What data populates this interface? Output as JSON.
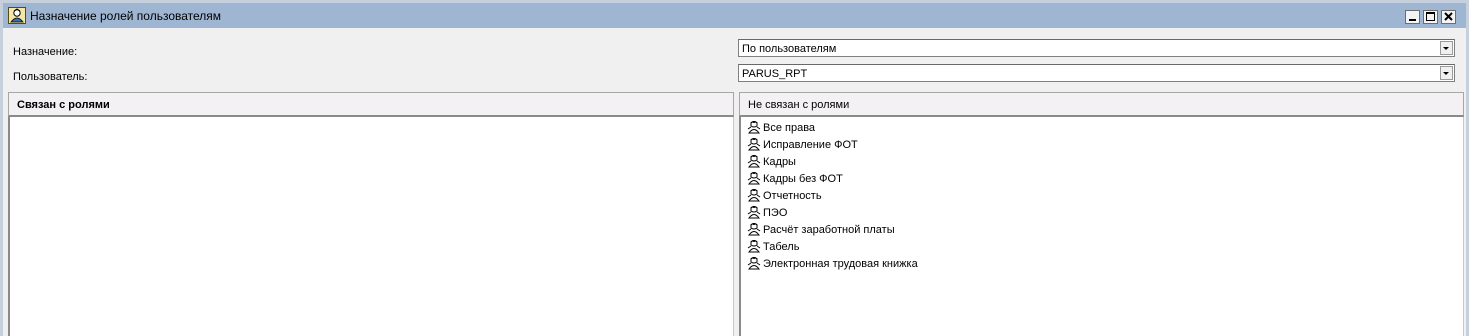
{
  "window": {
    "title": "Назначение ролей пользователям",
    "icon": "user-roles-icon",
    "controls": [
      "minimize-icon",
      "maximize-icon",
      "close-icon"
    ]
  },
  "form": {
    "assignment_label": "Назначение:",
    "assignment_value": "По пользователям",
    "user_label": "Пользователь:",
    "user_value": "PARUS_RPT"
  },
  "left_panel": {
    "header": "Связан с ролями",
    "items": []
  },
  "right_panel": {
    "header": "Не связан с ролями",
    "item_icon": "role-person-icon",
    "items": [
      "Все права",
      "Исправление ФОТ",
      "Кадры",
      "Кадры без ФОТ",
      "Отчетность",
      "ПЭО",
      "Расчёт заработной платы",
      "Табель",
      "Электронная трудовая книжка"
    ]
  },
  "colors": {
    "titlebar": "#9fb6d3",
    "window_bg": "#f0f0f0",
    "panel_header_bg": "#f4f1f5"
  }
}
